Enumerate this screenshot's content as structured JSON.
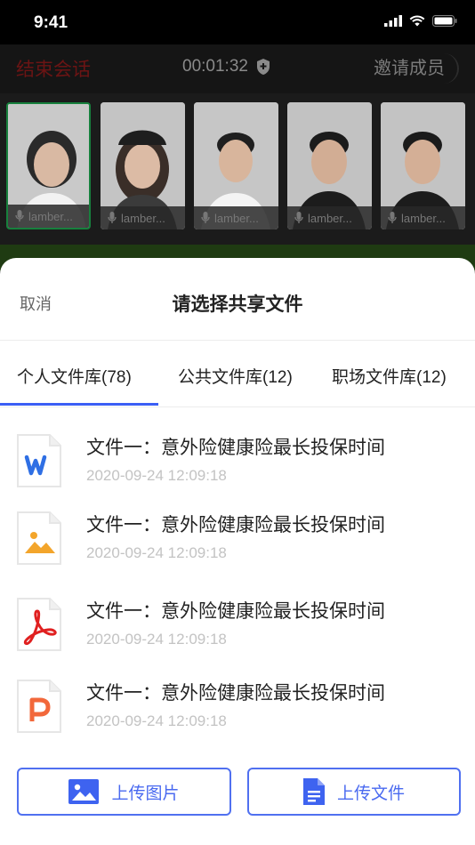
{
  "status_bar": {
    "time": "9:41"
  },
  "call": {
    "end_label": "结束会话",
    "timer": "00:01:32",
    "invite_label": "邀请成员",
    "participants": [
      {
        "name": "lamber...",
        "active": true
      },
      {
        "name": "lamber...",
        "active": false
      },
      {
        "name": "lamber...",
        "active": false
      },
      {
        "name": "lamber...",
        "active": false
      },
      {
        "name": "lamber...",
        "active": false
      }
    ]
  },
  "sheet": {
    "cancel_label": "取消",
    "title": "请选择共享文件",
    "tabs": [
      {
        "label": "个人文件库(78)",
        "selected": true
      },
      {
        "label": "公共文件库(12)",
        "selected": false
      },
      {
        "label": "职场文件库(12)",
        "selected": false
      }
    ],
    "files": [
      {
        "type": "word",
        "icon": "word-file-icon",
        "name": "文件一：意外险健康险最长投保时间",
        "date": "2020-09-24 12:09:18"
      },
      {
        "type": "image",
        "icon": "image-file-icon",
        "name": "文件一：意外险健康险最长投保时间",
        "date": "2020-09-24 12:09:18"
      },
      {
        "type": "pdf",
        "icon": "pdf-file-icon",
        "name": "文件一：意外险健康险最长投保时间",
        "date": "2020-09-24 12:09:18"
      },
      {
        "type": "ppt",
        "icon": "ppt-file-icon",
        "name": "文件一：意外险健康险最长投保时间",
        "date": "2020-09-24 12:09:18"
      }
    ],
    "upload_image_label": "上传图片",
    "upload_file_label": "上传文件"
  },
  "colors": {
    "accent": "#3b5ff5",
    "end_call": "#6b1414",
    "active_tile_border": "#17803d"
  }
}
